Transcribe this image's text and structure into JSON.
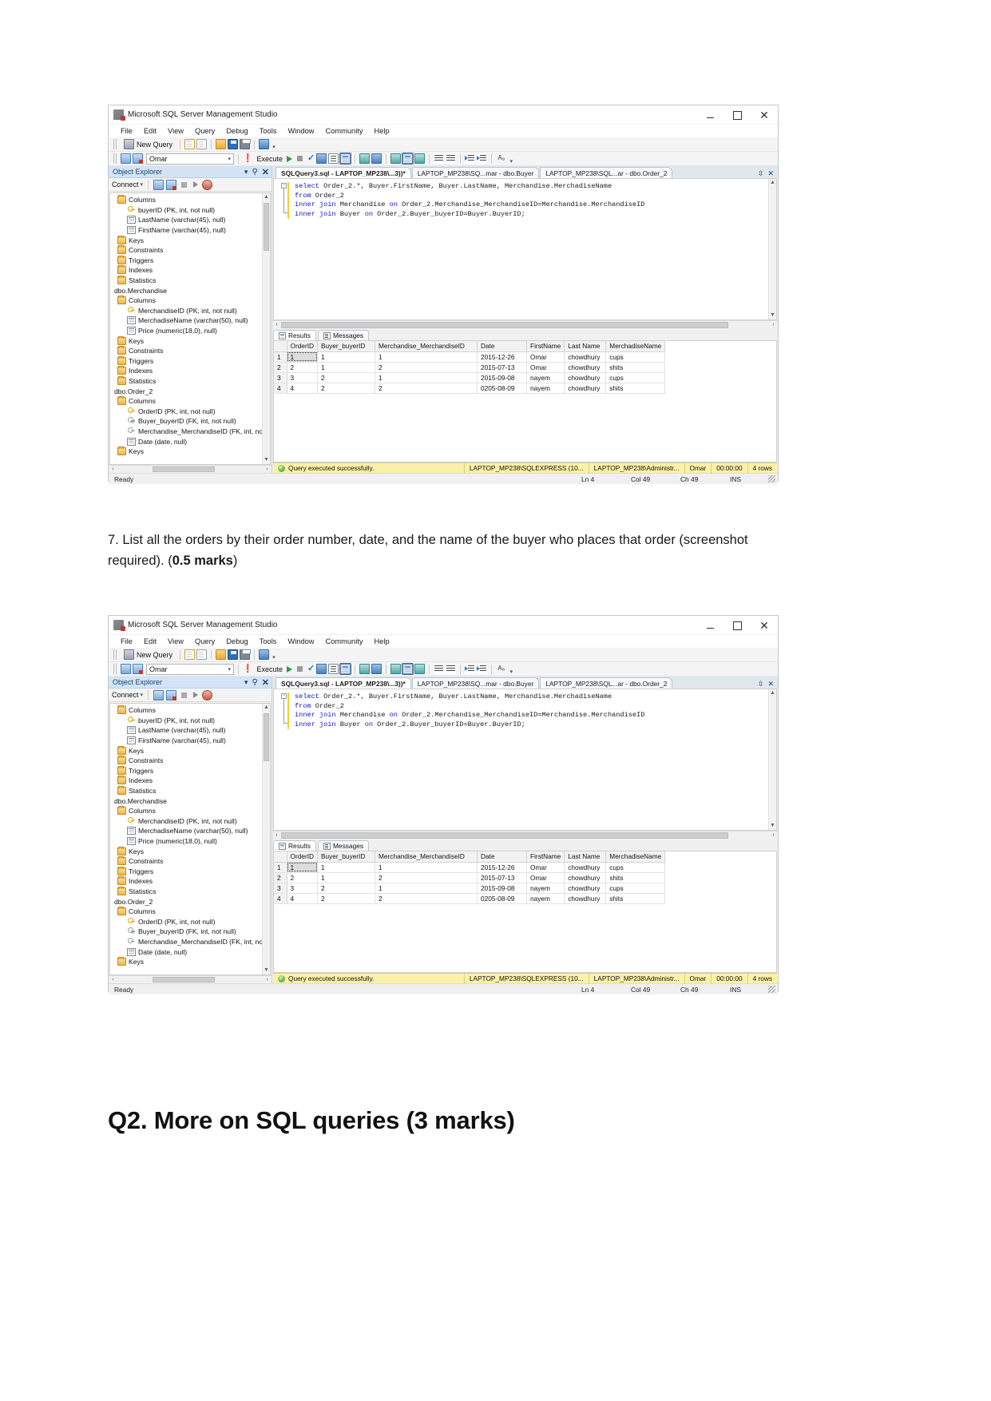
{
  "document": {
    "question": "7.  List all the orders by their order number, date, and the name of the buyer who places that order (screenshot required). (",
    "question_marks": "0.5 marks",
    "question_tail": ")",
    "heading": "Q2. More on SQL queries (3 marks)"
  },
  "app": {
    "title": "Microsoft SQL Server Management Studio",
    "menu": [
      "File",
      "Edit",
      "View",
      "Query",
      "Debug",
      "Tools",
      "Window",
      "Community",
      "Help"
    ],
    "toolbar1": {
      "new_query": "New Query"
    },
    "toolbar2": {
      "database": "Omar",
      "execute": "Execute"
    },
    "window_controls": {
      "minimize": "–",
      "maximize": "□",
      "close": "✕"
    }
  },
  "object_explorer": {
    "title": "Object Explorer",
    "connect_label": "Connect",
    "nodes": [
      {
        "label": "Columns",
        "icon": "folder-icon",
        "indent": 0
      },
      {
        "label": "buyerID (PK, int, not null)",
        "icon": "primary-key-icon",
        "indent": 1
      },
      {
        "label": "LastName (varchar(45), null)",
        "icon": "column-icon",
        "indent": 1
      },
      {
        "label": "FirstName (varchar(45), null)",
        "icon": "column-icon",
        "indent": 1
      },
      {
        "label": "Keys",
        "icon": "folder-icon",
        "indent": 0
      },
      {
        "label": "Constraints",
        "icon": "folder-icon",
        "indent": 0
      },
      {
        "label": "Triggers",
        "icon": "folder-icon",
        "indent": 0
      },
      {
        "label": "Indexes",
        "icon": "folder-icon",
        "indent": 0
      },
      {
        "label": "Statistics",
        "icon": "folder-icon",
        "indent": 0
      },
      {
        "label": "dbo.Merchandise",
        "icon": "none",
        "indent": -1
      },
      {
        "label": "Columns",
        "icon": "folder-icon",
        "indent": 0
      },
      {
        "label": "MerchandiseID (PK, int, not null)",
        "icon": "primary-key-icon",
        "indent": 1
      },
      {
        "label": "MerchadiseName (varchar(50), null)",
        "icon": "column-icon",
        "indent": 1
      },
      {
        "label": "Price (numeric(18,0), null)",
        "icon": "column-icon",
        "indent": 1
      },
      {
        "label": "Keys",
        "icon": "folder-icon",
        "indent": 0
      },
      {
        "label": "Constraints",
        "icon": "folder-icon",
        "indent": 0
      },
      {
        "label": "Triggers",
        "icon": "folder-icon",
        "indent": 0
      },
      {
        "label": "Indexes",
        "icon": "folder-icon",
        "indent": 0
      },
      {
        "label": "Statistics",
        "icon": "folder-icon",
        "indent": 0
      },
      {
        "label": "dbo.Order_2",
        "icon": "none",
        "indent": -1
      },
      {
        "label": "Columns",
        "icon": "folder-icon",
        "indent": 0
      },
      {
        "label": "OrderID (PK, int, not null)",
        "icon": "primary-key-icon",
        "indent": 1
      },
      {
        "label": "Buyer_buyerID (FK, int, not null)",
        "icon": "foreign-key-icon",
        "indent": 1
      },
      {
        "label": "Merchandise_MerchandiseID (FK, int, not r",
        "icon": "foreign-key-icon",
        "indent": 1
      },
      {
        "label": "Date (date, null)",
        "icon": "column-icon",
        "indent": 1
      },
      {
        "label": "Keys",
        "icon": "folder-icon",
        "indent": 0
      }
    ]
  },
  "editor": {
    "tabs": [
      {
        "label": "SQLQuery3.sql - LAPTOP_MP238\\...3))*",
        "active": true
      },
      {
        "label": "LAPTOP_MP238\\SQ...mar - dbo.Buyer",
        "active": false
      },
      {
        "label": "LAPTOP_MP238\\SQL...ar - dbo.Order_2",
        "active": false
      }
    ],
    "sql": [
      {
        "kw": "select",
        "rest": " Order_2.*, Buyer.FirstName, Buyer.LastName, Merchandise.MerchadiseName"
      },
      {
        "kw": "from",
        "rest": " Order_2"
      },
      {
        "kw": "inner join",
        "rest": " Merchandise ",
        "kw2": "on",
        "rest2": " Order_2.Merchandise_MerchandiseID=Merchandise.MerchandiseID"
      },
      {
        "kw": "inner join",
        "rest": " Buyer ",
        "kw2": "on",
        "rest2": " Order_2.Buyer_buyerID=Buyer.BuyerID;"
      }
    ]
  },
  "results": {
    "tabs": [
      {
        "label": "Results",
        "active": true
      },
      {
        "label": "Messages",
        "active": false
      }
    ],
    "columns": [
      "OrderID",
      "Buyer_buyerID",
      "Merchandise_MerchandiseID",
      "Date",
      "FirstName",
      "Last Name",
      "MerchadiseName"
    ],
    "rows": [
      {
        "n": "1",
        "cells": [
          "1",
          "1",
          "1",
          "2015-12-26",
          "Omar",
          "chowdhury",
          "cups"
        ]
      },
      {
        "n": "2",
        "cells": [
          "2",
          "1",
          "2",
          "2015-07-13",
          "Omar",
          "chowdhury",
          "shits"
        ]
      },
      {
        "n": "3",
        "cells": [
          "3",
          "2",
          "1",
          "2015-09-08",
          "nayem",
          "chowdhury",
          "cups"
        ]
      },
      {
        "n": "4",
        "cells": [
          "4",
          "2",
          "2",
          "0205-08-09",
          "nayem",
          "chowdhury",
          "shits"
        ]
      }
    ]
  },
  "query_status": {
    "message": "Query executed successfully.",
    "server": "LAPTOP_MP238\\SQLEXPRESS (10...",
    "user": "LAPTOP_MP238\\Administr...",
    "database": "Omar",
    "time": "00:00:00",
    "rows": "4 rows"
  },
  "status_bar": {
    "ready": "Ready",
    "line": "Ln 4",
    "col": "Col 49",
    "ch": "Ch 49",
    "ins": "INS"
  },
  "colors": {
    "oe_header": "#d4e3f5",
    "status_yellow": "#fbf0a8",
    "keyword_blue": "#1414c8",
    "accent": "#3a6ea5"
  }
}
